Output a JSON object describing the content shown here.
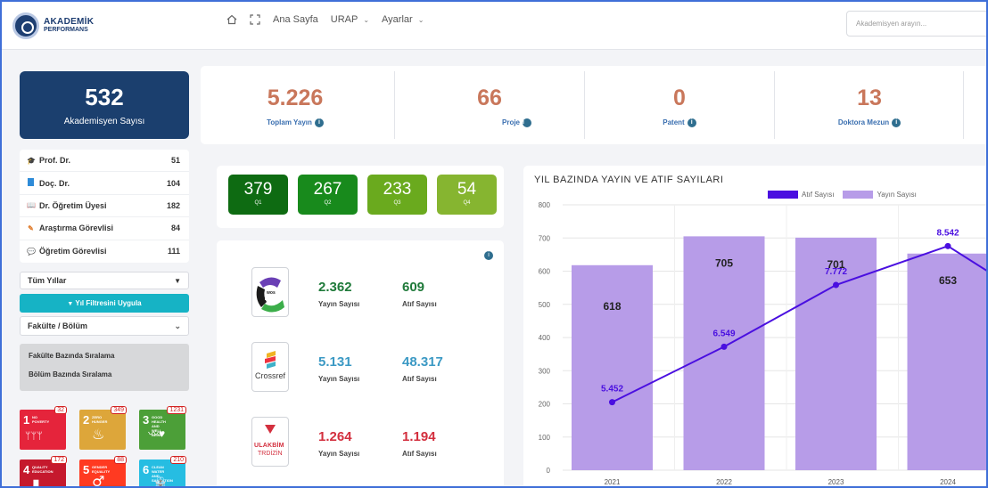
{
  "header": {
    "logo_line1": "AKADEMİK",
    "logo_line2": "PERFORMANS",
    "nav": [
      {
        "label": "Ana Sayfa"
      },
      {
        "label": "URAP"
      },
      {
        "label": "Ayarlar"
      }
    ],
    "search_placeholder": "Akademisyen arayın..."
  },
  "sidebar": {
    "academic_count": "532",
    "academic_count_label": "Akademisyen Sayısı",
    "ranks": [
      {
        "label": "Prof. Dr.",
        "count": "51",
        "icon": "graduation-cap-icon",
        "color": "#444444"
      },
      {
        "label": "Doç. Dr.",
        "count": "104",
        "icon": "book-icon",
        "color": "#2e8bd8"
      },
      {
        "label": "Dr. Öğretim Üyesi",
        "count": "182",
        "icon": "open-book-icon",
        "color": "#9ab6d8"
      },
      {
        "label": "Araştırma Görevlisi",
        "count": "84",
        "icon": "pencil-icon",
        "color": "#e07a2a"
      },
      {
        "label": "Öğretim Görevlisi",
        "count": "111",
        "icon": "chat-icon",
        "color": "#c9a7e0"
      }
    ],
    "year_select": "Tüm Yıllar",
    "apply_button": "Yıl Filtresini Uygula",
    "faculty_select": "Fakülte / Bölüm",
    "sort_options": [
      "Fakülte Bazında Sıralama",
      "Bölüm Bazında Sıralama"
    ],
    "sdg": [
      {
        "num": "1",
        "title": "NO POVERTY",
        "count": "32",
        "color": "#e5243b",
        "glyph": "ᛘᛘᛘ"
      },
      {
        "num": "2",
        "title": "ZERO HUNGER",
        "count": "349",
        "color": "#dda63a",
        "glyph": "♨"
      },
      {
        "num": "3",
        "title": "GOOD HEALTH AND WELL-BEING",
        "count": "1231",
        "color": "#4c9f38",
        "glyph": "〰♥"
      },
      {
        "num": "4",
        "title": "QUALITY EDUCATION",
        "count": "172",
        "color": "#c5192d",
        "glyph": "▮"
      },
      {
        "num": "5",
        "title": "GENDER EQUALITY",
        "count": "88",
        "color": "#ff3a21",
        "glyph": "⚥"
      },
      {
        "num": "6",
        "title": "CLEAN WATER AND SANITATION",
        "count": "210",
        "color": "#26bde2",
        "glyph": "⛲"
      }
    ]
  },
  "stats": [
    {
      "value": "5.226",
      "label": "Toplam Yayın"
    },
    {
      "value": "66",
      "label": "Proje"
    },
    {
      "value": "0",
      "label": "Patent"
    },
    {
      "value": "13",
      "label": "Doktora Mezun"
    }
  ],
  "quartiles": [
    {
      "value": "379",
      "label": "Q1",
      "color": "#0e6b12"
    },
    {
      "value": "267",
      "label": "Q2",
      "color": "#188a1c"
    },
    {
      "value": "233",
      "label": "Q3",
      "color": "#6aaa1e"
    },
    {
      "value": "54",
      "label": "Q4",
      "color": "#86b530"
    }
  ],
  "indexes": [
    {
      "name": "WoS",
      "logo_text": "wos",
      "pubs": "2.362",
      "pubs_label": "Yayın Sayısı",
      "cites": "609",
      "cites_label": "Atıf Sayısı",
      "color": "#1f7a3a"
    },
    {
      "name": "Crossref",
      "logo_text": "Crossref",
      "pubs": "5.131",
      "pubs_label": "Yayın Sayısı",
      "cites": "48.317",
      "cites_label": "Atıf Sayısı",
      "color": "#3b99c4"
    },
    {
      "name": "ULAKBİM TR DİZİN",
      "logo_text": "ULAKBİM",
      "logo_text2": "TRDİZİN",
      "pubs": "1.264",
      "pubs_label": "Yayın Sayısı",
      "cites": "1.194",
      "cites_label": "Atıf Sayısı",
      "color": "#d32f3e"
    }
  ],
  "chart_data": {
    "type": "bar",
    "title": "YIL BAZINDA YAYIN VE ATIF SAYILARI",
    "categories": [
      "2021",
      "2022",
      "2023",
      "2024"
    ],
    "ylim": [
      0,
      800
    ],
    "yticks": [
      0,
      100,
      200,
      300,
      400,
      500,
      600,
      700,
      800
    ],
    "grid": true,
    "legend_position": "top-center",
    "series": [
      {
        "name": "Yayın Sayısı",
        "type": "bar",
        "color": "#b79ce8",
        "values": [
          618,
          705,
          701,
          653
        ],
        "labels": [
          "618",
          "705",
          "701",
          "653"
        ]
      },
      {
        "name": "Atıf Sayısı",
        "type": "line",
        "color": "#4a0fe0",
        "values": [
          5452,
          6549,
          7772,
          8542
        ],
        "labels": [
          "5.452",
          "6.549",
          "7.772",
          "8.542"
        ]
      }
    ]
  }
}
